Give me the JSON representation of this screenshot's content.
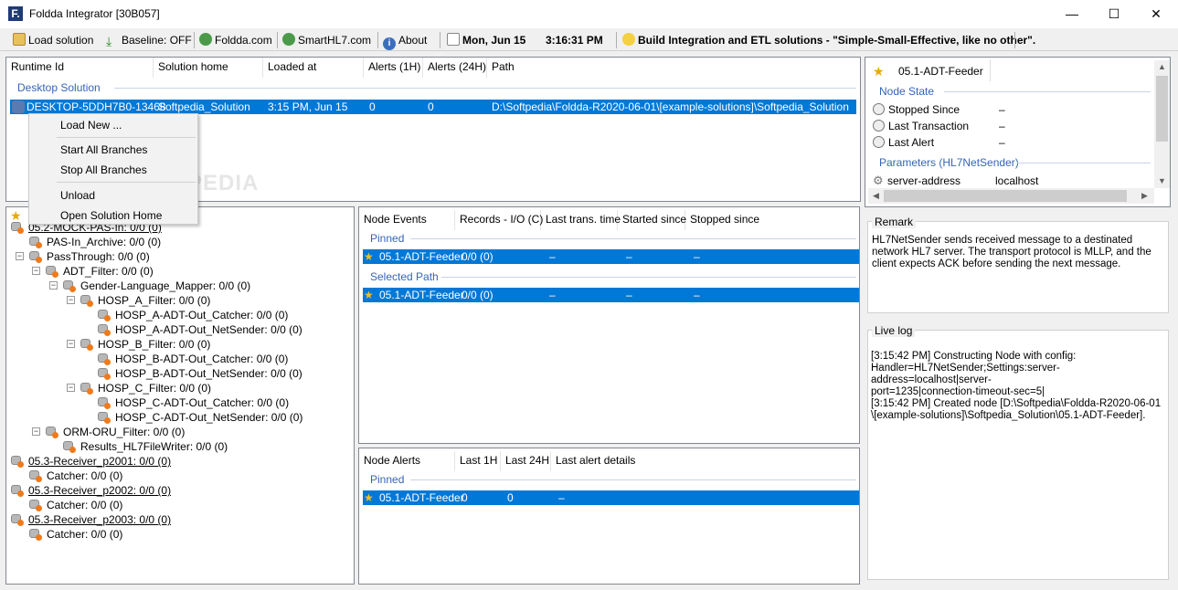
{
  "window": {
    "title": "Foldda Integrator [30B057]",
    "app_icon_letter": "F.",
    "minimize": "—",
    "maximize": "☐",
    "close": "✕"
  },
  "toolbar": {
    "load_solution": "Load solution",
    "baseline": "Baseline: OFF",
    "foldda_link": "Foldda.com",
    "smarthl7_link": "SmartHL7.com",
    "about": "About",
    "date": "Mon, Jun 15",
    "time": "3:16:31 PM",
    "tagline": "Build Integration and ETL solutions - \"Simple-Small-Effective, like no other\"."
  },
  "runtime_table": {
    "headers": [
      "Runtime Id",
      "Solution home",
      "Loaded at",
      "Alerts (1H)",
      "Alerts (24H)",
      "Path"
    ],
    "group": "Desktop Solution",
    "row": {
      "runtime_id": "DESKTOP-5DDH7B0-13468",
      "solution_home": "Softpedia_Solution",
      "loaded_at": "3:15 PM, Jun 15",
      "alerts_1h": "0",
      "alerts_24h": "0",
      "path": "D:\\Softpedia\\Foldda-R2020-06-01\\[example-solutions]\\Softpedia_Solution"
    }
  },
  "context_menu": {
    "items": [
      "Load New ...",
      "Start All Branches",
      "Stop All Branches",
      "Unload",
      "Open Solution Home"
    ]
  },
  "watermark": "SOFTPEDIA",
  "tree": {
    "nodes": [
      {
        "label": "05.2-MOCK-PAS-In: 0/0 (0)"
      },
      {
        "label": "PAS-In_Archive: 0/0 (0)"
      },
      {
        "label": "PassThrough: 0/0 (0)"
      },
      {
        "label": "ADT_Filter: 0/0 (0)"
      },
      {
        "label": "Gender-Language_Mapper: 0/0 (0)"
      },
      {
        "label": "HOSP_A_Filter: 0/0 (0)"
      },
      {
        "label": "HOSP_A-ADT-Out_Catcher: 0/0 (0)"
      },
      {
        "label": "HOSP_A-ADT-Out_NetSender: 0/0 (0)"
      },
      {
        "label": "HOSP_B_Filter: 0/0 (0)"
      },
      {
        "label": "HOSP_B-ADT-Out_Catcher: 0/0 (0)"
      },
      {
        "label": "HOSP_B-ADT-Out_NetSender: 0/0 (0)"
      },
      {
        "label": "HOSP_C_Filter: 0/0 (0)"
      },
      {
        "label": "HOSP_C-ADT-Out_Catcher: 0/0 (0)"
      },
      {
        "label": "HOSP_C-ADT-Out_NetSender: 0/0 (0)"
      },
      {
        "label": "ORM-ORU_Filter: 0/0 (0)"
      },
      {
        "label": "Results_HL7FileWriter: 0/0 (0)"
      },
      {
        "label": "05.3-Receiver_p2001: 0/0 (0)"
      },
      {
        "label": "Catcher: 0/0 (0)"
      },
      {
        "label": "05.3-Receiver_p2002: 0/0 (0)"
      },
      {
        "label": "Catcher: 0/0 (0)"
      },
      {
        "label": "05.3-Receiver_p2003: 0/0 (0)"
      },
      {
        "label": "Catcher: 0/0 (0)"
      }
    ]
  },
  "node_events": {
    "headers": [
      "Node Events",
      "Records - I/O (C)",
      "Last trans. time",
      "Started since",
      "Stopped since"
    ],
    "pinned_label": "Pinned",
    "selected_label": "Selected Path",
    "pinned_row": {
      "name": "05.1-ADT-Feeder",
      "records": "0/0 (0)",
      "last": "–",
      "started": "–",
      "stopped": "–"
    },
    "selected_row": {
      "name": "05.1-ADT-Feeder",
      "records": "0/0 (0)",
      "last": "–",
      "started": "–",
      "stopped": "–"
    }
  },
  "node_alerts": {
    "headers": [
      "Node Alerts",
      "Last 1H",
      "Last 24H",
      "Last alert details"
    ],
    "pinned_label": "Pinned",
    "row": {
      "name": "05.1-ADT-Feeder",
      "last1h": "0",
      "last24h": "0",
      "details": "–"
    }
  },
  "properties": {
    "node_name": "05.1-ADT-Feeder",
    "state_group": "Node State",
    "stopped_since": {
      "label": "Stopped Since",
      "value": "–"
    },
    "last_transaction": {
      "label": "Last Transaction",
      "value": "–"
    },
    "last_alert": {
      "label": "Last Alert",
      "value": "–"
    },
    "params_group": "Parameters (HL7NetSender)",
    "param_name": "server-address",
    "param_value": "localhost"
  },
  "remark": {
    "title": "Remark",
    "text": "HL7NetSender sends received message to a destinated network HL7 server. The transport protocol is MLLP, and the client expects ACK before sending the next message."
  },
  "live_log": {
    "title": "Live log",
    "lines": [
      "[3:15:42 PM] Constructing Node with config:",
      "Handler=HL7NetSender;Settings:server-address=localhost|server-",
      "port=1235|connection-timeout-sec=5|",
      "[3:15:42 PM] Created node [D:\\Softpedia\\Foldda-R2020-06-01",
      "\\[example-solutions]\\Softpedia_Solution\\05.1-ADT-Feeder]."
    ]
  },
  "colors": {
    "selection": "#0078d7",
    "group_label": "#3565b8",
    "node_orange": "#f07a1a"
  }
}
